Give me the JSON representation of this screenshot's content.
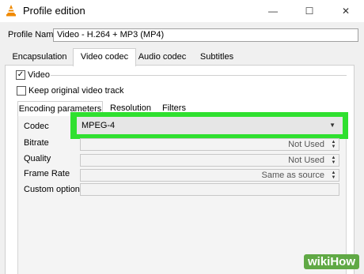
{
  "window": {
    "title": "Profile edition",
    "minimize_label": "—",
    "maximize_label": "☐",
    "close_label": "✕"
  },
  "profile": {
    "label": "Profile Name",
    "value": "Video - H.264 + MP3 (MP4)"
  },
  "tabs": [
    {
      "label": "Encapsulation"
    },
    {
      "label": "Video codec"
    },
    {
      "label": "Audio codec"
    },
    {
      "label": "Subtitles"
    }
  ],
  "video_section": {
    "video_checkbox_label": "Video",
    "video_checked_mark": "✓",
    "keep_original_label": "Keep original video track"
  },
  "inner_tabs": [
    {
      "label": "Encoding parameters"
    },
    {
      "label": "Resolution"
    },
    {
      "label": "Filters"
    }
  ],
  "fields": {
    "codec_label": "Codec",
    "codec_value": "MPEG-4",
    "bitrate_label": "Bitrate",
    "bitrate_value": "Not Used",
    "quality_label": "Quality",
    "quality_value": "Not Used",
    "framerate_label": "Frame Rate",
    "framerate_value": "Same as source",
    "custom_label": "Custom options"
  },
  "watermark": "wikiHow",
  "colors": {
    "highlight": "#2fe02f",
    "watermark_bg": "#60a945"
  }
}
